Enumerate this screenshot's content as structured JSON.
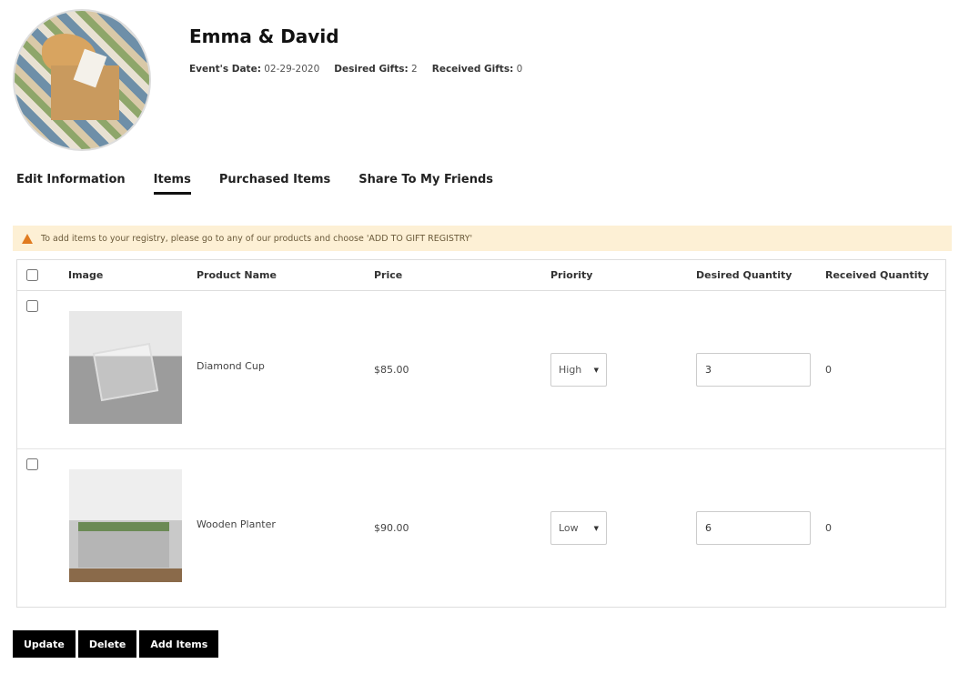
{
  "header": {
    "title": "Emma & David",
    "event_date_label": "Event's Date:",
    "event_date": "02-29-2020",
    "desired_gifts_label": "Desired Gifts:",
    "desired_gifts": "2",
    "received_gifts_label": "Received Gifts:",
    "received_gifts": "0"
  },
  "tabs": [
    {
      "label": "Edit Information"
    },
    {
      "label": "Items",
      "active": true
    },
    {
      "label": "Purchased Items"
    },
    {
      "label": "Share To My Friends"
    }
  ],
  "notice": {
    "icon": "warning-icon",
    "text": "To add items to your registry, please go to any of our products and choose 'ADD TO GIFT REGISTRY'"
  },
  "table": {
    "columns": [
      "Image",
      "Product Name",
      "Price",
      "Priority",
      "Desired Quantity",
      "Received Quantity"
    ],
    "rows": [
      {
        "name": "Diamond Cup",
        "price": "$85.00",
        "priority": "High",
        "desired": "3",
        "received": "0"
      },
      {
        "name": "Wooden Planter",
        "price": "$90.00",
        "priority": "Low",
        "desired": "6",
        "received": "0"
      }
    ]
  },
  "buttons": {
    "update": "Update",
    "delete": "Delete",
    "add": "Add Items"
  }
}
